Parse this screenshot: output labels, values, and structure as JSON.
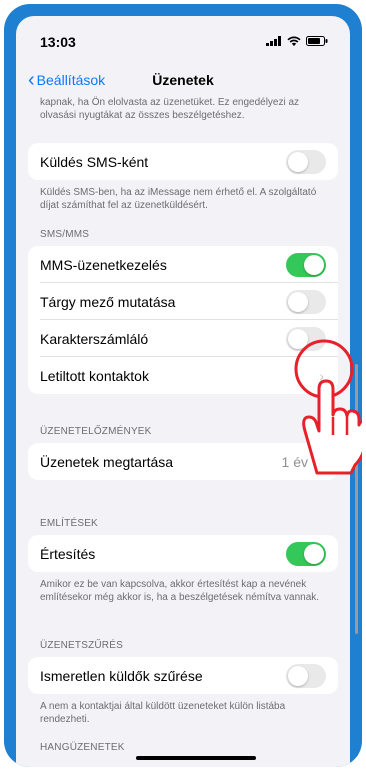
{
  "status": {
    "time": "13:03"
  },
  "nav": {
    "back_label": "Beállítások",
    "title": "Üzenetek"
  },
  "top_note": "kapnak, ha Ön elolvasta az üzenetüket. Ez engedélyezi az olvasási nyugtákat az összes beszélgetéshez.",
  "sms": {
    "label": "Küldés SMS-ként",
    "toggle_on": false,
    "note": "Küldés SMS-ben, ha az iMessage nem érhető el. A szolgáltató díjat számíthat fel az üzenetküldésért."
  },
  "smsmms": {
    "header": "SMS/MMS",
    "rows": [
      {
        "label": "MMS-üzenetkezelés",
        "toggle_on": true
      },
      {
        "label": "Tárgy mező mutatása",
        "toggle_on": false
      },
      {
        "label": "Karakterszámláló",
        "toggle_on": false
      },
      {
        "label": "Letiltott kontaktok"
      }
    ]
  },
  "history": {
    "header": "ÜZENETELŐZMÉNYEK",
    "label": "Üzenetek megtartása",
    "value": "1 év"
  },
  "mentions": {
    "header": "EMLÍTÉSEK",
    "label": "Értesítés",
    "toggle_on": true,
    "note": "Amikor ez be van kapcsolva, akkor értesítést kap a nevének említésekor még akkor is, ha a beszélgetések némítva vannak."
  },
  "filter": {
    "header": "ÜZENETSZŰRÉS",
    "label": "Ismeretlen küldők szűrése",
    "toggle_on": false,
    "note": "A nem a kontaktjai által küldött üzeneteket külön listába rendezheti."
  },
  "audio": {
    "header": "HANGÜZENETEK"
  },
  "colors": {
    "accent": "#0a7aff",
    "toggle_on": "#34c759",
    "device_frame": "#1f7fd0",
    "highlight": "#e8202a"
  },
  "icons": [
    "signal-icon",
    "wifi-icon",
    "battery-icon",
    "chevron-left-icon",
    "chevron-right-icon",
    "tap-hand-icon"
  ]
}
